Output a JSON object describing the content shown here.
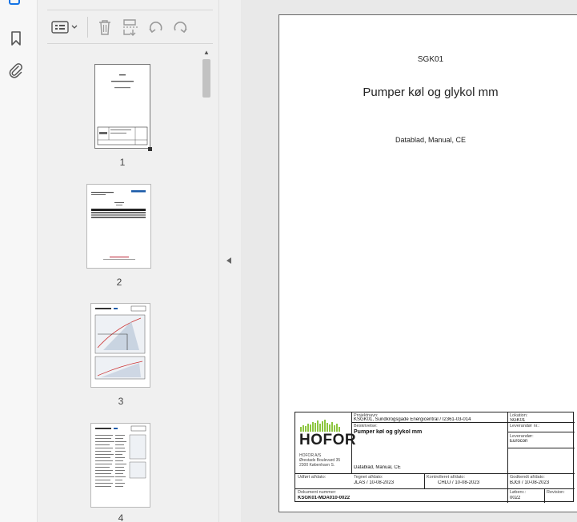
{
  "left_rail": {
    "icons": [
      "bookmark-icon",
      "attachment-icon"
    ]
  },
  "thumbnail_panel": {
    "toolbar_icons": [
      "thumbnail-options-icon",
      "delete-page-icon",
      "extract-page-icon",
      "rotate-counterclockwise-icon",
      "rotate-clockwise-icon"
    ],
    "pages": [
      {
        "number": "1"
      },
      {
        "number": "2"
      },
      {
        "number": "3"
      },
      {
        "number": "4"
      }
    ]
  },
  "document": {
    "code": "SGK01",
    "title": "Pumper køl og glykol mm",
    "subtitle": "Datablad, Manual, CE",
    "title_block": {
      "company": "HOFOR",
      "address_lines": [
        "HOFOR A/S",
        "Ørestads Boulevard 35",
        "2300 København S."
      ],
      "projektnavn_label": "Projektnavn:",
      "projektnavn_value": "KSGK01, Sundkrogsgade Energicentral / I2361-03-014",
      "beskrivelse_label": "Beskrivelse:",
      "beskrivelse_value": "Pumper køl og glykol mm",
      "beskrivelse_detail": "Datablad, Manual, CE",
      "lokation_label": "Lokation:",
      "lokation_value": "SGK01",
      "leverandor_nr_label": "Leverandør nr.:",
      "leverandor_label": "Leverandør:",
      "leverandor_value": "Eurocon",
      "udfort_label": "Udført af/dato:",
      "tegnet_label": "Tegnet af/dato:",
      "tegnet_value": "JLAS / 10-08-2023",
      "kontrolleret_label": "Kontrolleret af/dato:",
      "kontrolleret_value": "CHLU / 10-08-2023",
      "godkendt_label": "Godkendt af/dato:",
      "godkendt_value": "BJGI / 10-08-2023",
      "dokument_label": "Dokument nummer:",
      "dokument_value": "KSGK01-MDA010-0022",
      "lobenr_label": "Løbenr.:",
      "lobenr_value": "0022",
      "revision_label": "Revision:"
    }
  },
  "colors": {
    "accent": "#1473e6",
    "logo_green": "#8dc63f"
  }
}
